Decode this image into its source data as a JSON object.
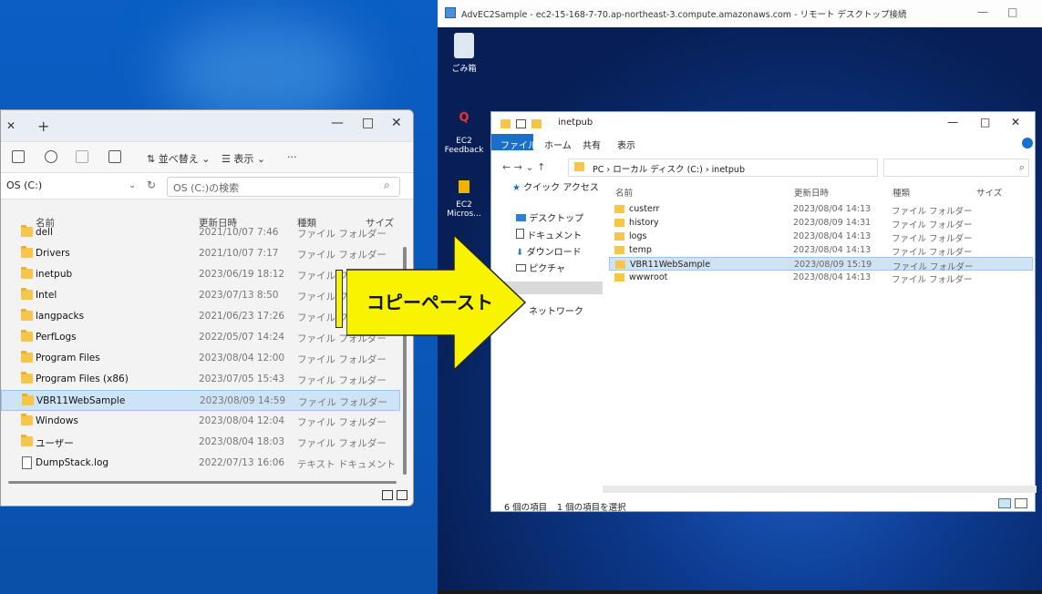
{
  "left_window": {
    "tab_close": "✕",
    "tab_plus": "+",
    "controls": {
      "minimize": "—",
      "maximize": "□",
      "close": "✕"
    },
    "toolbar": {
      "sort_label": "並べ替え",
      "view_label": "表示",
      "more": "···"
    },
    "address": "OS (C:)",
    "search_placeholder": "OS (C:)の検索",
    "columns": {
      "name": "名前",
      "date": "更新日時",
      "type": "種類",
      "size": "サイズ"
    },
    "rows": [
      {
        "name": "dell",
        "date": "2021/10/07 7:46",
        "type": "ファイル フォルダー"
      },
      {
        "name": "Drivers",
        "date": "2021/10/07 7:17",
        "type": "ファイル フォルダー"
      },
      {
        "name": "inetpub",
        "date": "2023/06/19 18:12",
        "type": "ファイル フォルダー"
      },
      {
        "name": "Intel",
        "date": "2023/07/13 8:50",
        "type": "ファイル フォルダー"
      },
      {
        "name": "langpacks",
        "date": "2021/06/23 17:26",
        "type": "ファイル フォルダー"
      },
      {
        "name": "PerfLogs",
        "date": "2022/05/07 14:24",
        "type": "ファイル フォルダー"
      },
      {
        "name": "Program Files",
        "date": "2023/08/04 12:00",
        "type": "ファイル フォルダー"
      },
      {
        "name": "Program Files (x86)",
        "date": "2023/07/05 15:43",
        "type": "ファイル フォルダー"
      },
      {
        "name": "VBR11WebSample",
        "date": "2023/08/09 14:59",
        "type": "ファイル フォルダー"
      },
      {
        "name": "Windows",
        "date": "2023/08/04 12:04",
        "type": "ファイル フォルダー"
      },
      {
        "name": "ユーザー",
        "date": "2023/08/04 18:03",
        "type": "ファイル フォルダー"
      },
      {
        "name": "DumpStack.log",
        "date": "2022/07/13 16:06",
        "type": "テキスト ドキュメント"
      }
    ]
  },
  "arrow_label": "コピーペースト",
  "rdp": {
    "title": "AdvEC2Sample - ec2-15-168-7-70.ap-northeast-3.compute.amazonaws.com - リモート デスクトップ接続",
    "desktop_icons": {
      "recycle": "ごみ箱",
      "feedback": "EC2 Feedback",
      "ec2": "EC2\nMicros..."
    },
    "explorer": {
      "title": "inetpub",
      "ribbon": [
        "ファイル",
        "ホーム",
        "共有",
        "表示"
      ],
      "breadcrumb": "PC  ›  ローカル ディスク (C:)  ›  inetpub",
      "nav": [
        "クイック アクセス",
        "デスクトップ",
        "ドキュメント",
        "ダウンロード",
        "ピクチャ",
        "ネットワーク"
      ],
      "columns": {
        "name": "名前",
        "date": "更新日時",
        "type": "種類",
        "size": "サイズ"
      },
      "rows": [
        {
          "name": "custerr",
          "date": "2023/08/04 14:13",
          "type": "ファイル フォルダー"
        },
        {
          "name": "history",
          "date": "2023/08/09 14:31",
          "type": "ファイル フォルダー"
        },
        {
          "name": "logs",
          "date": "2023/08/04 14:13",
          "type": "ファイル フォルダー"
        },
        {
          "name": "temp",
          "date": "2023/08/04 14:13",
          "type": "ファイル フォルダー"
        },
        {
          "name": "VBR11WebSample",
          "date": "2023/08/09 15:19",
          "type": "ファイル フォルダー"
        },
        {
          "name": "wwwroot",
          "date": "2023/08/04 14:13",
          "type": "ファイル フォルダー"
        }
      ],
      "status_count": "6 個の項目",
      "status_selected": "1 個の項目を選択"
    }
  }
}
